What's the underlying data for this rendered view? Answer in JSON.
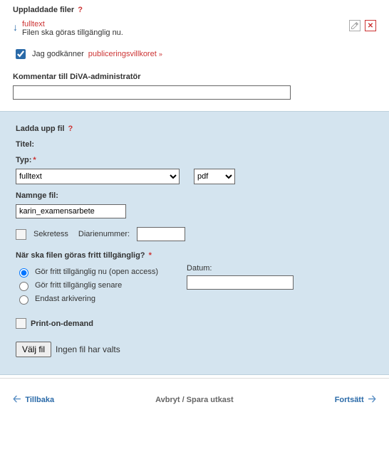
{
  "uploaded": {
    "heading": "Uppladdade filer",
    "help": "?",
    "file_name": "fulltext",
    "file_desc": "Filen ska göras tillgänglig nu."
  },
  "accept": {
    "checked": true,
    "prefix": "Jag godkänner",
    "link": "publiceringsvillkoret",
    "arrow": "»"
  },
  "comment": {
    "label": "Kommentar till DiVA-administratör",
    "value": ""
  },
  "upload": {
    "heading": "Ladda upp fil",
    "help": "?",
    "title_label": "Titel:",
    "type_label": "Typ:",
    "type_value": "fulltext",
    "format_value": "pdf",
    "name_label": "Namnge fil:",
    "name_value": "karin_examensarbete",
    "secrecy_label": "Sekretess",
    "diary_label": "Diarienummer:",
    "diary_value": "",
    "access_label": "När ska filen göras fritt tillgänglig?",
    "radio_now": "Gör fritt tillgänglig nu (open access)",
    "radio_later": "Gör fritt tillgänglig senare",
    "radio_archive": "Endast arkivering",
    "date_label": "Datum:",
    "date_value": "",
    "pod_label": "Print-on-demand",
    "choose_btn": "Välj fil",
    "no_file": "Ingen fil har valts"
  },
  "nav": {
    "back": "Tillbaka",
    "middle": "Avbryt / Spara utkast",
    "next": "Fortsätt"
  }
}
